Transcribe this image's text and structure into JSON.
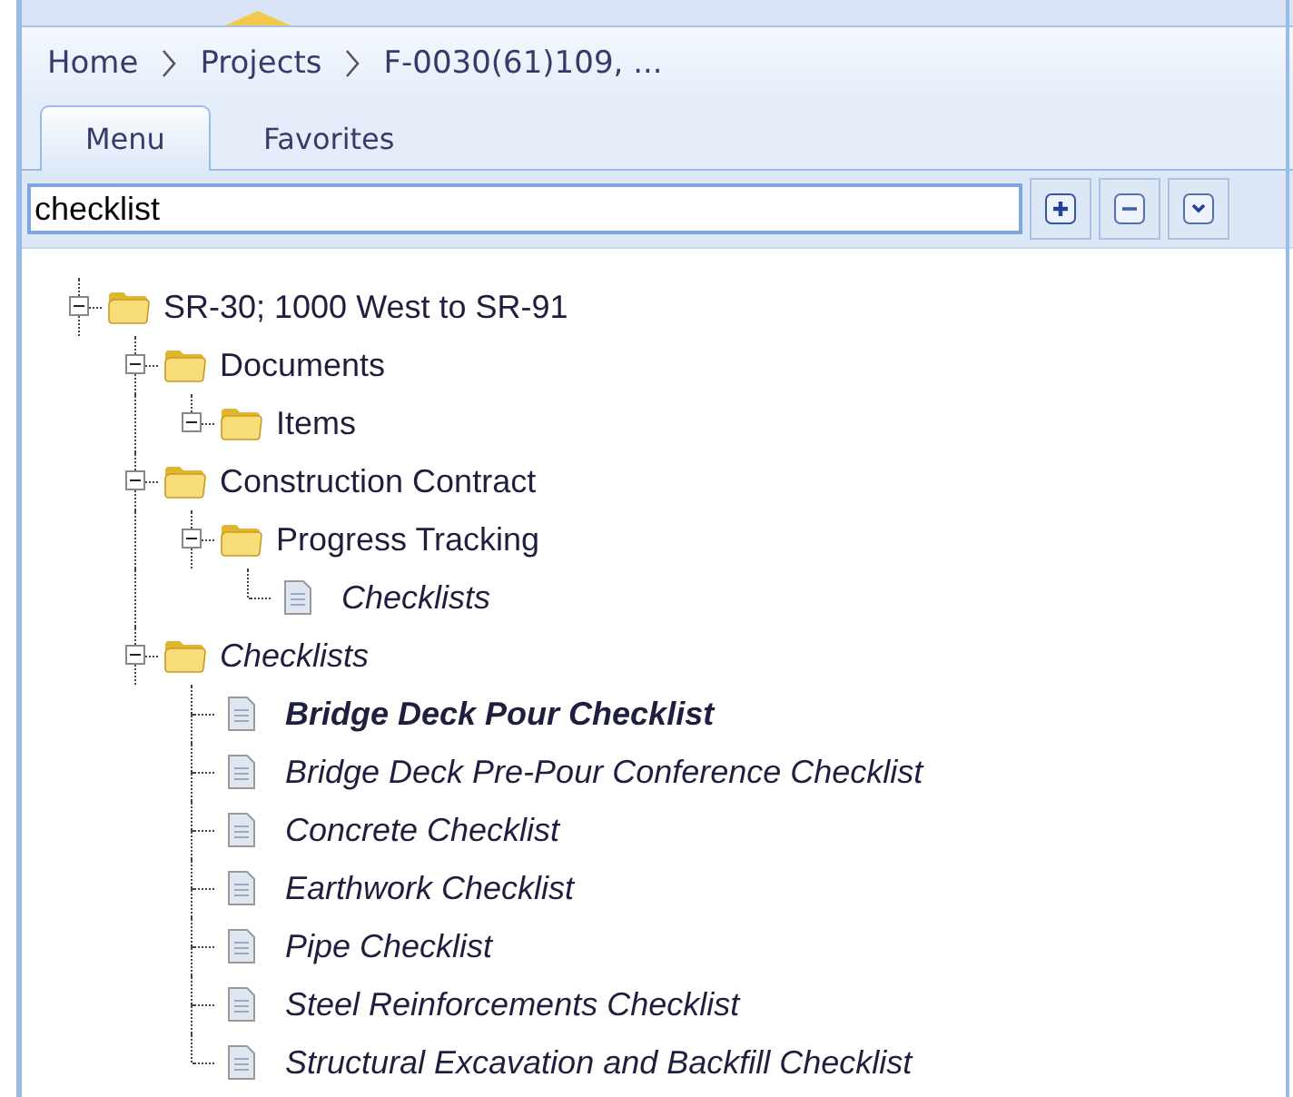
{
  "breadcrumb": [
    {
      "label": "Home"
    },
    {
      "label": "Projects"
    },
    {
      "label": "F-0030(61)109, ..."
    }
  ],
  "tabs": [
    {
      "label": "Menu",
      "selected": true
    },
    {
      "label": "Favorites",
      "selected": false
    }
  ],
  "search": {
    "value": "checklist"
  },
  "tree": [
    {
      "label": "SR-30; 1000 West to SR-91",
      "kind": "folder",
      "expanded": true,
      "match": false,
      "selected": false,
      "children": [
        {
          "label": "Documents",
          "kind": "folder",
          "expanded": true,
          "match": false,
          "selected": false,
          "children": [
            {
              "label": "Items",
              "kind": "folder",
              "expanded": true,
              "match": false,
              "selected": false
            }
          ]
        },
        {
          "label": "Construction Contract",
          "kind": "folder",
          "expanded": true,
          "match": false,
          "selected": false,
          "children": [
            {
              "label": "Progress Tracking",
              "kind": "folder",
              "expanded": true,
              "match": false,
              "selected": false,
              "children": [
                {
                  "label": "Checklists",
                  "kind": "document",
                  "match": true,
                  "selected": false
                }
              ]
            }
          ]
        },
        {
          "label": "Checklists",
          "kind": "folder",
          "expanded": true,
          "match": true,
          "selected": false,
          "children": [
            {
              "label": "Bridge Deck Pour Checklist",
              "kind": "document",
              "match": true,
              "selected": true
            },
            {
              "label": "Bridge Deck Pre-Pour Conference Checklist",
              "kind": "document",
              "match": true,
              "selected": false
            },
            {
              "label": "Concrete Checklist",
              "kind": "document",
              "match": true,
              "selected": false
            },
            {
              "label": "Earthwork Checklist",
              "kind": "document",
              "match": true,
              "selected": false
            },
            {
              "label": "Pipe Checklist",
              "kind": "document",
              "match": true,
              "selected": false
            },
            {
              "label": "Steel Reinforcements Checklist",
              "kind": "document",
              "match": true,
              "selected": false
            },
            {
              "label": "Structural Excavation and Backfill Checklist",
              "kind": "document",
              "match": true,
              "selected": false
            }
          ]
        }
      ]
    }
  ]
}
